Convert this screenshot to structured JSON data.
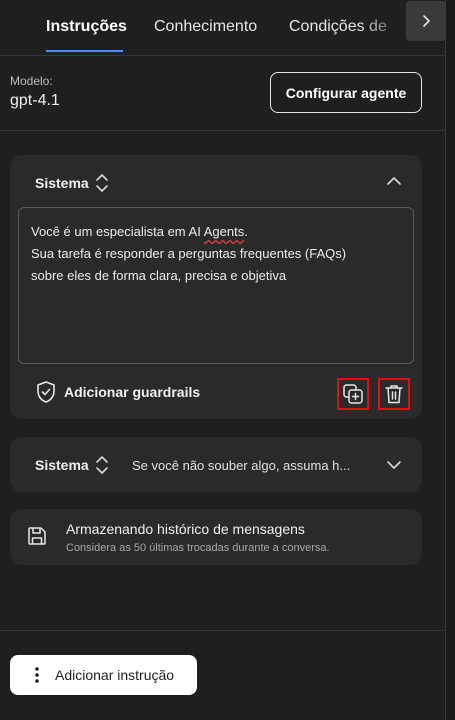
{
  "tabs": [
    {
      "label": "Instruções",
      "active": true
    },
    {
      "label": "Conhecimento",
      "active": false
    },
    {
      "label": "Condições de",
      "active": false
    }
  ],
  "model": {
    "label": "Modelo:",
    "value": "gpt-4.1",
    "configure_button": "Configurar agente"
  },
  "instruction_1": {
    "type": "Sistema",
    "expanded": true,
    "text_lines": [
      {
        "before": "Você é um especialista em AI ",
        "misspelled": "Agents",
        "after": "."
      },
      {
        "text": "Sua tarefa é responder a perguntas frequentes (FAQs)"
      },
      {
        "text": "sobre eles de forma clara, precisa e objetiva"
      }
    ],
    "guardrails_label": "Adicionar guardrails"
  },
  "instruction_2": {
    "type": "Sistema",
    "expanded": false,
    "preview": "Se você não souber algo, assuma h..."
  },
  "history": {
    "title": "Armazenando histórico de mensagens",
    "subtitle": "Considera as 50 últimas trocadas durante a conversa."
  },
  "footer": {
    "add_instruction": "Adicionar instrução"
  },
  "colors": {
    "accent": "#4a8cff",
    "highlight_border": "#e01010",
    "background": "#1f1f1f",
    "card": "#2a2a2a"
  }
}
